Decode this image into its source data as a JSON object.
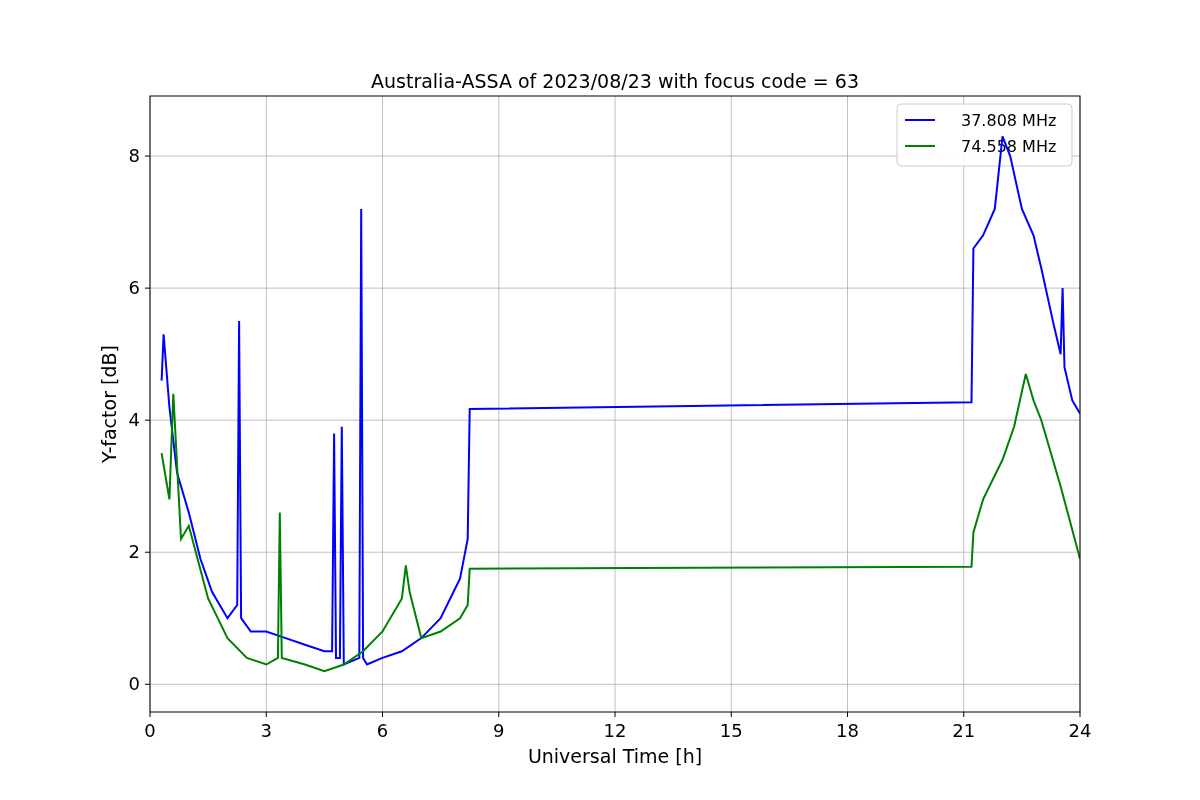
{
  "chart_data": {
    "type": "line",
    "grid": true,
    "legend": true,
    "title": "Australia-ASSA of 2023/08/23 with focus code = 63",
    "xlabel": "Universal Time [h]",
    "ylabel": "Y-factor [dB]",
    "xlim": [
      0,
      24
    ],
    "ylim": [
      -0.42,
      8.91
    ],
    "xticks": [
      0,
      3,
      6,
      9,
      12,
      15,
      18,
      21,
      24
    ],
    "yticks": [
      0,
      2,
      4,
      6,
      8
    ],
    "series": [
      {
        "name": "37.808 MHz",
        "color": "#0000ff",
        "x": [
          0.3,
          0.35,
          0.5,
          0.7,
          1,
          1.3,
          1.6,
          2,
          2.25,
          2.3,
          2.35,
          2.6,
          3,
          3.5,
          4,
          4.5,
          4.7,
          4.75,
          4.8,
          4.9,
          4.95,
          5,
          5.4,
          5.45,
          5.5,
          5.6,
          6,
          6.5,
          7,
          7.5,
          8,
          8.2,
          8.25,
          21.2,
          21.25,
          21.5,
          21.8,
          22,
          22.2,
          22.5,
          22.8,
          23,
          23.3,
          23.5,
          23.55,
          23.6,
          23.8,
          24
        ],
        "values": [
          4.6,
          5.3,
          4.2,
          3.2,
          2.6,
          1.9,
          1.4,
          1.0,
          1.2,
          5.5,
          1.0,
          0.8,
          0.8,
          0.7,
          0.6,
          0.5,
          0.5,
          3.8,
          0.4,
          0.4,
          3.9,
          0.3,
          0.4,
          7.2,
          0.4,
          0.3,
          0.4,
          0.5,
          0.7,
          1.0,
          1.6,
          2.2,
          4.17,
          4.27,
          6.6,
          6.8,
          7.2,
          8.3,
          8.0,
          7.2,
          6.8,
          6.3,
          5.5,
          5.0,
          6.0,
          4.8,
          4.3,
          4.1
        ]
      },
      {
        "name": "74.558 MHz",
        "color": "#008000",
        "x": [
          0.3,
          0.5,
          0.6,
          0.8,
          1,
          1.5,
          2,
          2.5,
          3,
          3.3,
          3.35,
          3.4,
          4,
          4.5,
          5,
          5.5,
          6,
          6.5,
          6.6,
          6.7,
          7,
          7.5,
          8,
          8.2,
          8.25,
          21.2,
          21.25,
          21.5,
          22,
          22.3,
          22.6,
          22.8,
          23,
          23.5,
          24
        ],
        "values": [
          3.5,
          2.8,
          4.4,
          2.2,
          2.4,
          1.3,
          0.7,
          0.4,
          0.3,
          0.4,
          2.6,
          0.4,
          0.3,
          0.2,
          0.3,
          0.5,
          0.8,
          1.3,
          1.8,
          1.4,
          0.7,
          0.8,
          1.0,
          1.2,
          1.75,
          1.78,
          2.3,
          2.8,
          3.4,
          3.9,
          4.7,
          4.3,
          4.0,
          3.0,
          1.9
        ]
      }
    ]
  }
}
